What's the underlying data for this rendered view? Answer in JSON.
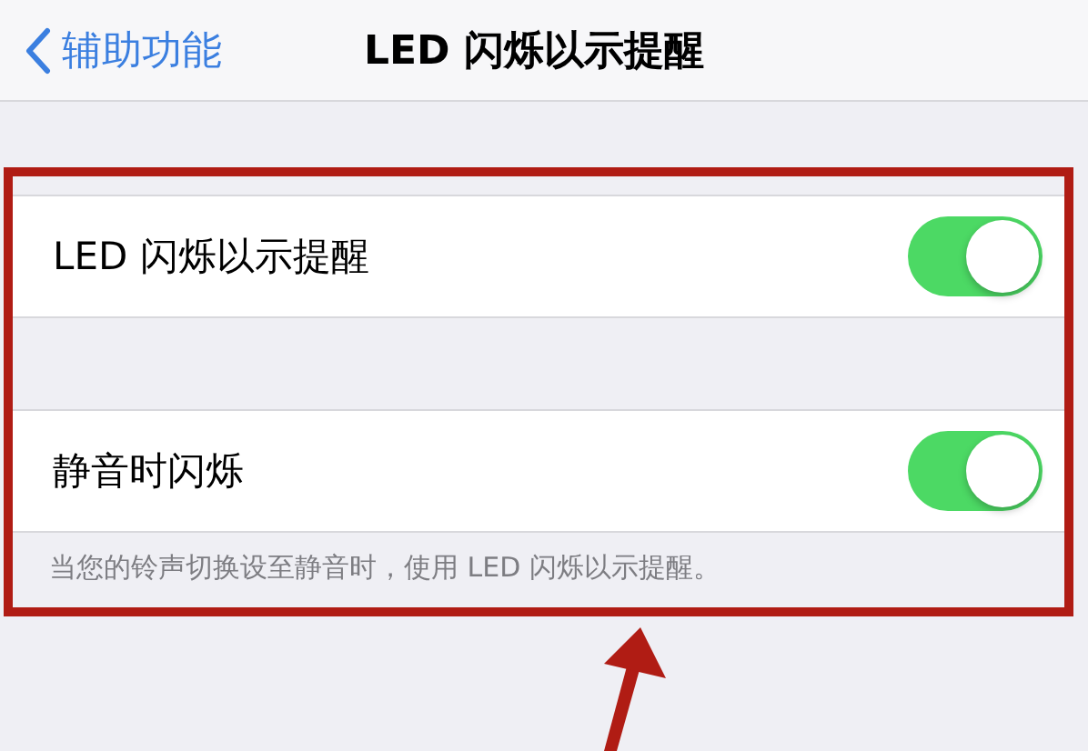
{
  "nav_bar": {
    "back_label": "辅助功能",
    "title": "LED 闪烁以示提醒"
  },
  "settings": [
    {
      "label": "LED 闪烁以示提醒",
      "on": true
    },
    {
      "label": "静音时闪烁",
      "on": true
    }
  ],
  "footer_note": "当您的铃声切换设至静音时，使用 LED 闪烁以示提醒。"
}
